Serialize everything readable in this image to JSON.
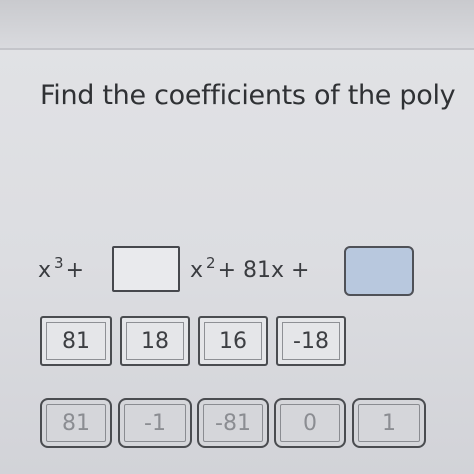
{
  "question": {
    "text": "Find the coefficients of the poly"
  },
  "equation": {
    "prefix": "x",
    "prefix_exp": "3",
    "prefix_op": "+",
    "middle": "x",
    "middle_exp": "2",
    "middle_rest": "+ 81x +"
  },
  "tiles_row1": [
    "81",
    "18",
    "16",
    "-18"
  ],
  "tiles_row2": [
    "81",
    "-1",
    "-81",
    "0",
    "1"
  ],
  "colors": {
    "background": "#dcdde1",
    "filled_drop_zone": "#b8c8de",
    "border": "#4a4c50"
  }
}
